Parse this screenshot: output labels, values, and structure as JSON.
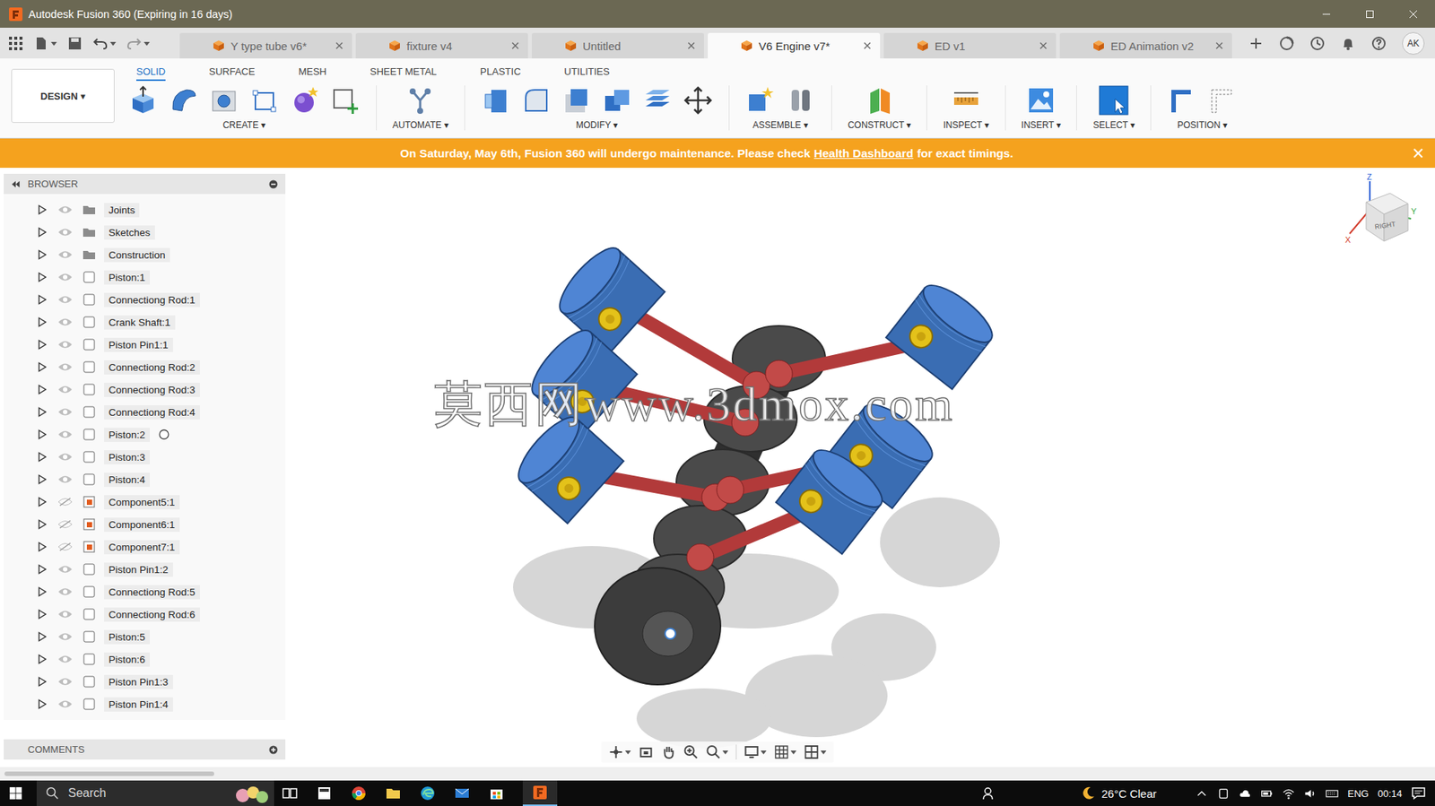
{
  "window": {
    "title": "Autodesk Fusion 360 (Expiring in 16 days)"
  },
  "doc_tabs": [
    {
      "label": "Y type tube v6*",
      "selected": false
    },
    {
      "label": "fixture v4",
      "selected": false
    },
    {
      "label": "Untitled",
      "selected": false
    },
    {
      "label": "V6 Engine v7*",
      "selected": true
    },
    {
      "label": "ED v1",
      "selected": false
    },
    {
      "label": "ED Animation v2",
      "selected": false
    }
  ],
  "user": {
    "initials": "AK"
  },
  "workspace": {
    "label": "DESIGN ▾"
  },
  "toolbar_tabs": [
    {
      "label": "SOLID",
      "selected": true
    },
    {
      "label": "SURFACE",
      "selected": false
    },
    {
      "label": "MESH",
      "selected": false
    },
    {
      "label": "SHEET METAL",
      "selected": false
    },
    {
      "label": "PLASTIC",
      "selected": false
    },
    {
      "label": "UTILITIES",
      "selected": false
    }
  ],
  "tool_groups": [
    {
      "label": "CREATE ▾",
      "kind": "create"
    },
    {
      "label": "AUTOMATE ▾",
      "kind": "automate"
    },
    {
      "label": "MODIFY ▾",
      "kind": "modify"
    },
    {
      "label": "ASSEMBLE ▾",
      "kind": "assemble"
    },
    {
      "label": "CONSTRUCT ▾",
      "kind": "construct"
    },
    {
      "label": "INSPECT ▾",
      "kind": "inspect"
    },
    {
      "label": "INSERT ▾",
      "kind": "insert"
    },
    {
      "label": "SELECT ▾",
      "kind": "select"
    },
    {
      "label": "POSITION ▾",
      "kind": "position"
    }
  ],
  "banner": {
    "before": "On Saturday, May 6th, Fusion 360 will undergo maintenance. Please check",
    "link": "Health Dashboard",
    "after": "for exact timings."
  },
  "browser": {
    "title": "BROWSER",
    "items": [
      {
        "name": "Joints",
        "kind": "folder",
        "visible": true,
        "hovered": false
      },
      {
        "name": "Sketches",
        "kind": "folder",
        "visible": true,
        "hovered": false
      },
      {
        "name": "Construction",
        "kind": "folder",
        "visible": true,
        "hovered": false
      },
      {
        "name": "Piston:1",
        "kind": "component",
        "visible": true,
        "hovered": false
      },
      {
        "name": "Connectiong Rod:1",
        "kind": "component",
        "visible": true,
        "hovered": false
      },
      {
        "name": "Crank Shaft:1",
        "kind": "component",
        "visible": true,
        "hovered": false
      },
      {
        "name": "Piston Pin1:1",
        "kind": "component",
        "visible": true,
        "hovered": false
      },
      {
        "name": "Connectiong Rod:2",
        "kind": "component",
        "visible": true,
        "hovered": false
      },
      {
        "name": "Connectiong Rod:3",
        "kind": "component",
        "visible": true,
        "hovered": false
      },
      {
        "name": "Connectiong Rod:4",
        "kind": "component",
        "visible": true,
        "hovered": false
      },
      {
        "name": "Piston:2",
        "kind": "component",
        "visible": true,
        "hovered": true
      },
      {
        "name": "Piston:3",
        "kind": "component",
        "visible": true,
        "hovered": false
      },
      {
        "name": "Piston:4",
        "kind": "component",
        "visible": true,
        "hovered": false
      },
      {
        "name": "Component5:1",
        "kind": "linked",
        "visible": false,
        "hovered": false
      },
      {
        "name": "Component6:1",
        "kind": "linked",
        "visible": false,
        "hovered": false
      },
      {
        "name": "Component7:1",
        "kind": "linked",
        "visible": false,
        "hovered": false
      },
      {
        "name": "Piston Pin1:2",
        "kind": "component",
        "visible": true,
        "hovered": false
      },
      {
        "name": "Connectiong Rod:5",
        "kind": "component",
        "visible": true,
        "hovered": false
      },
      {
        "name": "Connectiong Rod:6",
        "kind": "component",
        "visible": true,
        "hovered": false
      },
      {
        "name": "Piston:5",
        "kind": "component",
        "visible": true,
        "hovered": false
      },
      {
        "name": "Piston:6",
        "kind": "component",
        "visible": true,
        "hovered": false
      },
      {
        "name": "Piston Pin1:3",
        "kind": "component",
        "visible": true,
        "hovered": false
      },
      {
        "name": "Piston Pin1:4",
        "kind": "component",
        "visible": true,
        "hovered": false
      }
    ]
  },
  "comments": {
    "title": "COMMENTS"
  },
  "viewcube": {
    "face": "RIGHT",
    "axes": [
      {
        "label": "Z",
        "color": "#2c5fd6"
      },
      {
        "label": "Y",
        "color": "#3aa845"
      },
      {
        "label": "X",
        "color": "#d23a2a"
      }
    ]
  },
  "watermark": "莫西网www.3dmox.com",
  "taskbar": {
    "search_placeholder": "Search",
    "weather": "26°C Clear",
    "language": "ENG",
    "time": "00:14"
  }
}
